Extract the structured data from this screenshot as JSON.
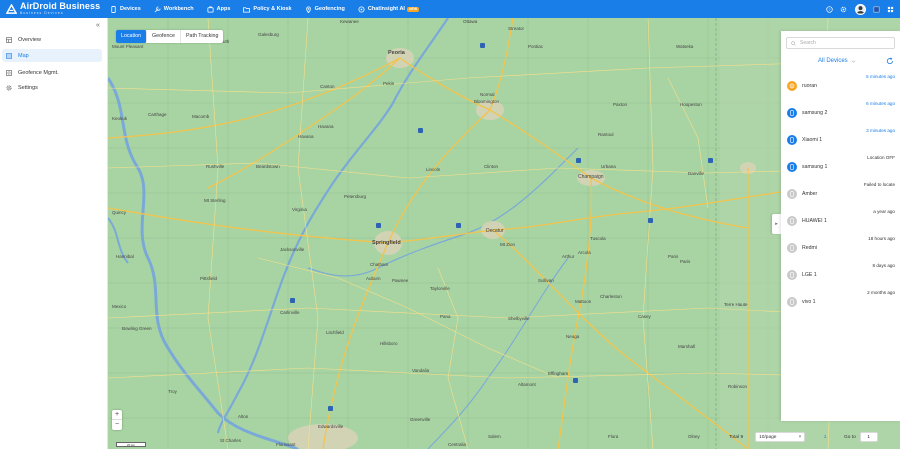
{
  "app": {
    "brand": "AirDroid Business",
    "sub": "Business Devices"
  },
  "nav": [
    {
      "label": "Devices",
      "icon": "device-icon"
    },
    {
      "label": "Workbench",
      "icon": "wrench-icon"
    },
    {
      "label": "Apps",
      "icon": "apps-icon"
    },
    {
      "label": "Policy & Kiosk",
      "icon": "folder-icon"
    },
    {
      "label": "Geofencing",
      "icon": "geofence-icon"
    },
    {
      "label": "ChatInsight AI",
      "icon": "chat-icon",
      "badge": "NEW"
    }
  ],
  "sidebar": {
    "items": [
      {
        "label": "Overview",
        "icon": "overview-icon"
      },
      {
        "label": "Map",
        "icon": "map-icon"
      },
      {
        "label": "Geofence Mgmt.",
        "icon": "geofence-mgmt-icon"
      },
      {
        "label": "Settings",
        "icon": "settings-icon"
      }
    ]
  },
  "tabs": [
    "Location",
    "Geofence",
    "Path Tracking"
  ],
  "panel": {
    "search_placeholder": "Search",
    "filter_label": "All Devices",
    "devices": [
      {
        "name": "ruoran",
        "time": "5 minutes ago",
        "type": "android",
        "status": "online"
      },
      {
        "name": "samsung 2",
        "time": "6 minutes ago",
        "type": "phone",
        "status": "online"
      },
      {
        "name": "Xiaomi 1",
        "time": "3 minutes ago",
        "type": "phone",
        "status": "online"
      },
      {
        "name": "samsung 1",
        "time": "Location OFF",
        "type": "phone",
        "status": "warn"
      },
      {
        "name": "Amber",
        "time": "Failed to locate",
        "type": "phone",
        "status": "offline"
      },
      {
        "name": "HUAWEI 1",
        "time": "a year ago",
        "type": "phone",
        "status": "offline"
      },
      {
        "name": "Redmi",
        "time": "18 hours ago",
        "type": "phone",
        "status": "offline"
      },
      {
        "name": "LGE 1",
        "time": "8 days ago",
        "type": "phone",
        "status": "offline"
      },
      {
        "name": "vivo 1",
        "time": "2 months ago",
        "type": "phone",
        "status": "offline"
      }
    ]
  },
  "footer": {
    "total": "Total 9",
    "page_size": "10/page",
    "current_page": "1",
    "goto_label": "Go to",
    "goto_value": "1"
  },
  "map": {
    "zoom_in": "+",
    "zoom_out": "−",
    "scale": "20 km",
    "labels": [
      {
        "t": "Peoria"
      },
      {
        "t": "Normal"
      },
      {
        "t": "Bloomington"
      },
      {
        "t": "Champaign"
      },
      {
        "t": "Decatur"
      },
      {
        "t": "Springfield"
      },
      {
        "t": "Danville"
      },
      {
        "t": "Quincy"
      },
      {
        "t": "Jacksonville"
      },
      {
        "t": "Effingham"
      },
      {
        "t": "Pekin"
      },
      {
        "t": "Lincoln"
      },
      {
        "t": "Clinton"
      },
      {
        "t": "Urbana"
      },
      {
        "t": "Mattoon"
      },
      {
        "t": "Charleston"
      },
      {
        "t": "Taylorville"
      },
      {
        "t": "Macomb"
      },
      {
        "t": "Canton"
      },
      {
        "t": "Galesburg"
      },
      {
        "t": "Kewanee"
      },
      {
        "t": "Pontiac"
      },
      {
        "t": "Paxton"
      },
      {
        "t": "Rantoul"
      },
      {
        "t": "Tuscola"
      },
      {
        "t": "Shelbyville"
      },
      {
        "t": "Litchfield"
      },
      {
        "t": "Carlinville"
      },
      {
        "t": "Hillsboro"
      },
      {
        "t": "Pana"
      },
      {
        "t": "Vandalia"
      },
      {
        "t": "Greenville"
      },
      {
        "t": "Alton"
      },
      {
        "t": "Edwardsville"
      },
      {
        "t": "Beardstown"
      },
      {
        "t": "Havana"
      },
      {
        "t": "Rushville"
      },
      {
        "t": "Pittsfield"
      },
      {
        "t": "Hannibal"
      },
      {
        "t": "Mt Sterling"
      },
      {
        "t": "Carthage"
      },
      {
        "t": "Keokuk"
      },
      {
        "t": "Monmouth"
      },
      {
        "t": "Mount Pleasant"
      },
      {
        "t": "Watseka"
      },
      {
        "t": "Hoopeston"
      },
      {
        "t": "Paris"
      },
      {
        "t": "Robinson"
      },
      {
        "t": "Olney"
      },
      {
        "t": "Salem"
      },
      {
        "t": "Centralia"
      },
      {
        "t": "Mexico"
      },
      {
        "t": "Bowling Green"
      },
      {
        "t": "Troy"
      },
      {
        "t": "St Charles"
      },
      {
        "t": "Florissant"
      },
      {
        "t": "Marshall"
      },
      {
        "t": "Terre Haute"
      },
      {
        "t": "Ottawa"
      },
      {
        "t": "Streator"
      },
      {
        "t": "Havana"
      },
      {
        "t": "Petersburg"
      },
      {
        "t": "Virginia"
      },
      {
        "t": "Chatham"
      },
      {
        "t": "Auburn"
      },
      {
        "t": "Pawnee"
      },
      {
        "t": "Mt Zion"
      },
      {
        "t": "Sullivan"
      },
      {
        "t": "Arthur"
      },
      {
        "t": "Arcola"
      },
      {
        "t": "Paris"
      },
      {
        "t": "Casey"
      },
      {
        "t": "Neoga"
      },
      {
        "t": "Altamont"
      },
      {
        "t": "Flora"
      }
    ]
  }
}
